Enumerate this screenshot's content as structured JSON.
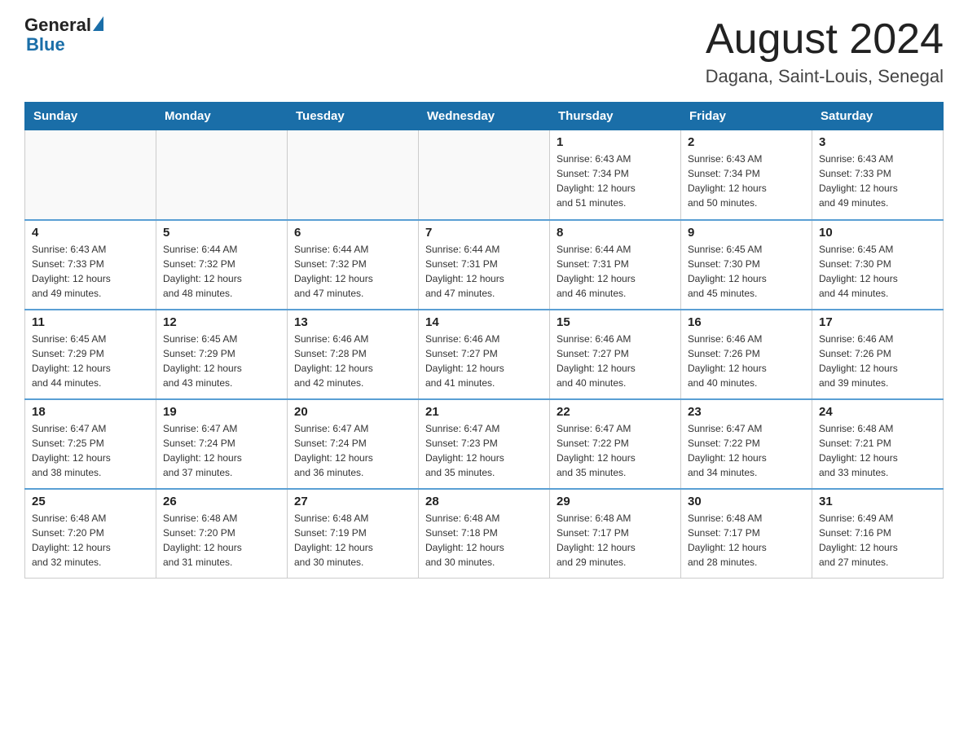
{
  "header": {
    "logo": {
      "general": "General",
      "blue": "Blue"
    },
    "title": "August 2024",
    "location": "Dagana, Saint-Louis, Senegal"
  },
  "weekdays": [
    "Sunday",
    "Monday",
    "Tuesday",
    "Wednesday",
    "Thursday",
    "Friday",
    "Saturday"
  ],
  "weeks": [
    [
      {
        "day": "",
        "info": ""
      },
      {
        "day": "",
        "info": ""
      },
      {
        "day": "",
        "info": ""
      },
      {
        "day": "",
        "info": ""
      },
      {
        "day": "1",
        "info": "Sunrise: 6:43 AM\nSunset: 7:34 PM\nDaylight: 12 hours\nand 51 minutes."
      },
      {
        "day": "2",
        "info": "Sunrise: 6:43 AM\nSunset: 7:34 PM\nDaylight: 12 hours\nand 50 minutes."
      },
      {
        "day": "3",
        "info": "Sunrise: 6:43 AM\nSunset: 7:33 PM\nDaylight: 12 hours\nand 49 minutes."
      }
    ],
    [
      {
        "day": "4",
        "info": "Sunrise: 6:43 AM\nSunset: 7:33 PM\nDaylight: 12 hours\nand 49 minutes."
      },
      {
        "day": "5",
        "info": "Sunrise: 6:44 AM\nSunset: 7:32 PM\nDaylight: 12 hours\nand 48 minutes."
      },
      {
        "day": "6",
        "info": "Sunrise: 6:44 AM\nSunset: 7:32 PM\nDaylight: 12 hours\nand 47 minutes."
      },
      {
        "day": "7",
        "info": "Sunrise: 6:44 AM\nSunset: 7:31 PM\nDaylight: 12 hours\nand 47 minutes."
      },
      {
        "day": "8",
        "info": "Sunrise: 6:44 AM\nSunset: 7:31 PM\nDaylight: 12 hours\nand 46 minutes."
      },
      {
        "day": "9",
        "info": "Sunrise: 6:45 AM\nSunset: 7:30 PM\nDaylight: 12 hours\nand 45 minutes."
      },
      {
        "day": "10",
        "info": "Sunrise: 6:45 AM\nSunset: 7:30 PM\nDaylight: 12 hours\nand 44 minutes."
      }
    ],
    [
      {
        "day": "11",
        "info": "Sunrise: 6:45 AM\nSunset: 7:29 PM\nDaylight: 12 hours\nand 44 minutes."
      },
      {
        "day": "12",
        "info": "Sunrise: 6:45 AM\nSunset: 7:29 PM\nDaylight: 12 hours\nand 43 minutes."
      },
      {
        "day": "13",
        "info": "Sunrise: 6:46 AM\nSunset: 7:28 PM\nDaylight: 12 hours\nand 42 minutes."
      },
      {
        "day": "14",
        "info": "Sunrise: 6:46 AM\nSunset: 7:27 PM\nDaylight: 12 hours\nand 41 minutes."
      },
      {
        "day": "15",
        "info": "Sunrise: 6:46 AM\nSunset: 7:27 PM\nDaylight: 12 hours\nand 40 minutes."
      },
      {
        "day": "16",
        "info": "Sunrise: 6:46 AM\nSunset: 7:26 PM\nDaylight: 12 hours\nand 40 minutes."
      },
      {
        "day": "17",
        "info": "Sunrise: 6:46 AM\nSunset: 7:26 PM\nDaylight: 12 hours\nand 39 minutes."
      }
    ],
    [
      {
        "day": "18",
        "info": "Sunrise: 6:47 AM\nSunset: 7:25 PM\nDaylight: 12 hours\nand 38 minutes."
      },
      {
        "day": "19",
        "info": "Sunrise: 6:47 AM\nSunset: 7:24 PM\nDaylight: 12 hours\nand 37 minutes."
      },
      {
        "day": "20",
        "info": "Sunrise: 6:47 AM\nSunset: 7:24 PM\nDaylight: 12 hours\nand 36 minutes."
      },
      {
        "day": "21",
        "info": "Sunrise: 6:47 AM\nSunset: 7:23 PM\nDaylight: 12 hours\nand 35 minutes."
      },
      {
        "day": "22",
        "info": "Sunrise: 6:47 AM\nSunset: 7:22 PM\nDaylight: 12 hours\nand 35 minutes."
      },
      {
        "day": "23",
        "info": "Sunrise: 6:47 AM\nSunset: 7:22 PM\nDaylight: 12 hours\nand 34 minutes."
      },
      {
        "day": "24",
        "info": "Sunrise: 6:48 AM\nSunset: 7:21 PM\nDaylight: 12 hours\nand 33 minutes."
      }
    ],
    [
      {
        "day": "25",
        "info": "Sunrise: 6:48 AM\nSunset: 7:20 PM\nDaylight: 12 hours\nand 32 minutes."
      },
      {
        "day": "26",
        "info": "Sunrise: 6:48 AM\nSunset: 7:20 PM\nDaylight: 12 hours\nand 31 minutes."
      },
      {
        "day": "27",
        "info": "Sunrise: 6:48 AM\nSunset: 7:19 PM\nDaylight: 12 hours\nand 30 minutes."
      },
      {
        "day": "28",
        "info": "Sunrise: 6:48 AM\nSunset: 7:18 PM\nDaylight: 12 hours\nand 30 minutes."
      },
      {
        "day": "29",
        "info": "Sunrise: 6:48 AM\nSunset: 7:17 PM\nDaylight: 12 hours\nand 29 minutes."
      },
      {
        "day": "30",
        "info": "Sunrise: 6:48 AM\nSunset: 7:17 PM\nDaylight: 12 hours\nand 28 minutes."
      },
      {
        "day": "31",
        "info": "Sunrise: 6:49 AM\nSunset: 7:16 PM\nDaylight: 12 hours\nand 27 minutes."
      }
    ]
  ]
}
